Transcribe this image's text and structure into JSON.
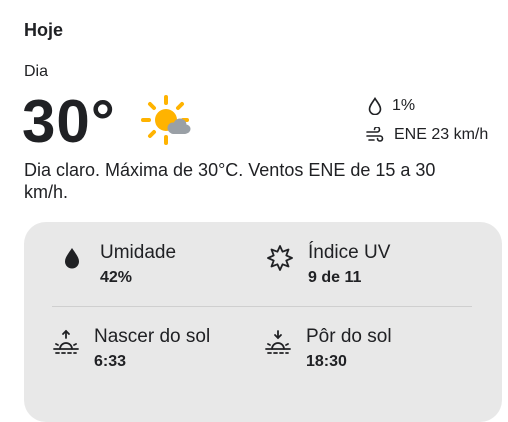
{
  "header": {
    "title": "Hoje",
    "period": "Dia"
  },
  "current": {
    "temperature": "30°",
    "weather_icon": "sun-partly-cloudy-icon",
    "precipitation": "1%",
    "wind": "ENE 23 km/h",
    "description": "Dia claro. Máxima de 30°C. Ventos ENE de 15 a 30 km/h."
  },
  "details": {
    "humidity": {
      "label": "Umidade",
      "value": "42%",
      "icon": "water-drop-icon"
    },
    "uv": {
      "label": "Índice UV",
      "value": "9 de 11",
      "icon": "sun-outline-icon"
    },
    "sunrise": {
      "label": "Nascer do sol",
      "value": "6:33",
      "icon": "sunrise-icon"
    },
    "sunset": {
      "label": "Pôr do sol",
      "value": "18:30",
      "icon": "sunset-icon"
    }
  },
  "colors": {
    "sun": "#FFB300",
    "cloud": "#9AA0A6",
    "card_bg": "#E8E8E8",
    "text": "#202124"
  }
}
